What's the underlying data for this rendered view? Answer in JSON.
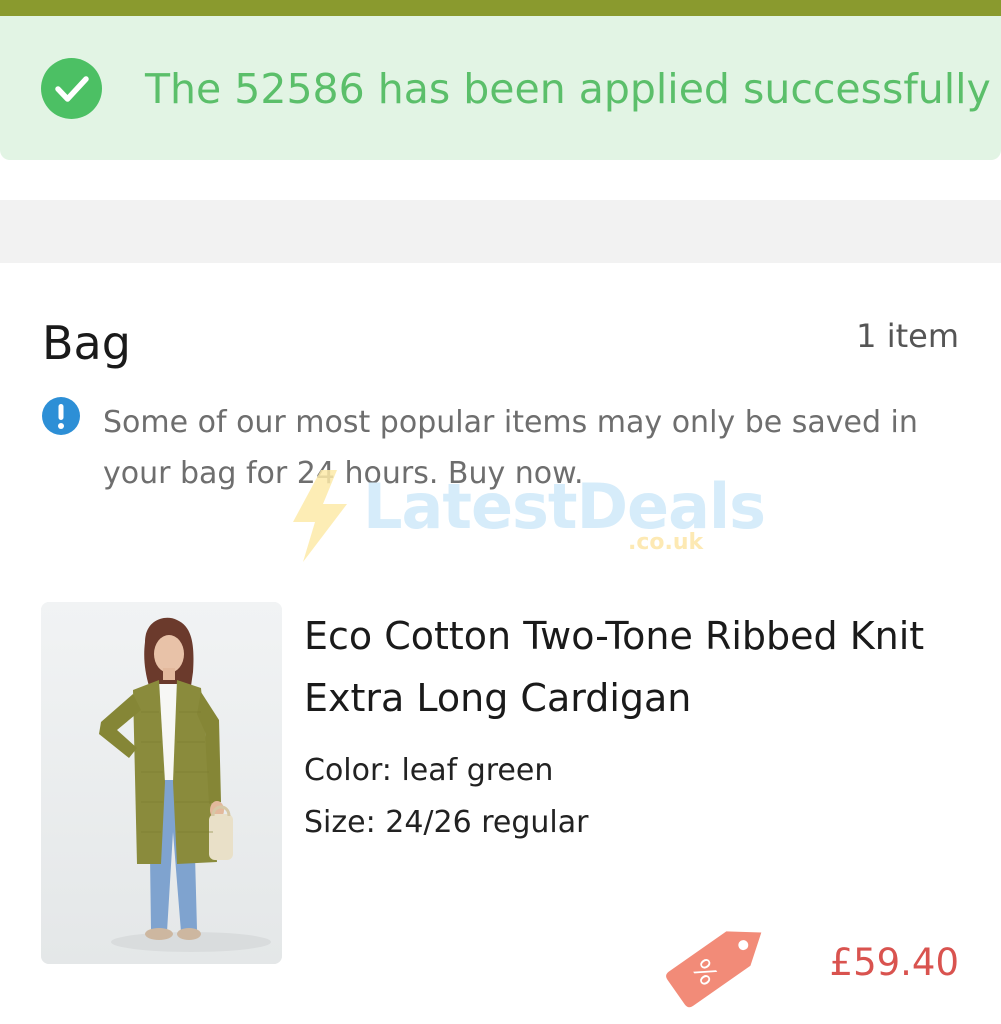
{
  "banner": {
    "message": "The 52586 has been applied successfully",
    "icon": "check-circle-icon",
    "color": "#5bbf6a"
  },
  "bag": {
    "title": "Bag",
    "item_count": "1 item",
    "notice": "Some of our most popular items may only be saved in your bag for 24 hours. Buy now.",
    "notice_icon": "info-icon"
  },
  "watermark": {
    "brand": "LatestDeals",
    "domain": ".co.uk"
  },
  "product": {
    "title": "Eco Cotton Two-Tone Ribbed Knit Extra Long Cardigan",
    "color_line": "Color: leaf green",
    "size_line": "Size: 24/26 regular",
    "price": "£59.40",
    "discount_icon": "percent-tag-icon"
  },
  "colors": {
    "accent_bar": "#8a9a2e",
    "success_bg": "#e2f4e4",
    "price": "#d9534f",
    "info": "#2d8fd6",
    "tag": "#f28b78"
  }
}
